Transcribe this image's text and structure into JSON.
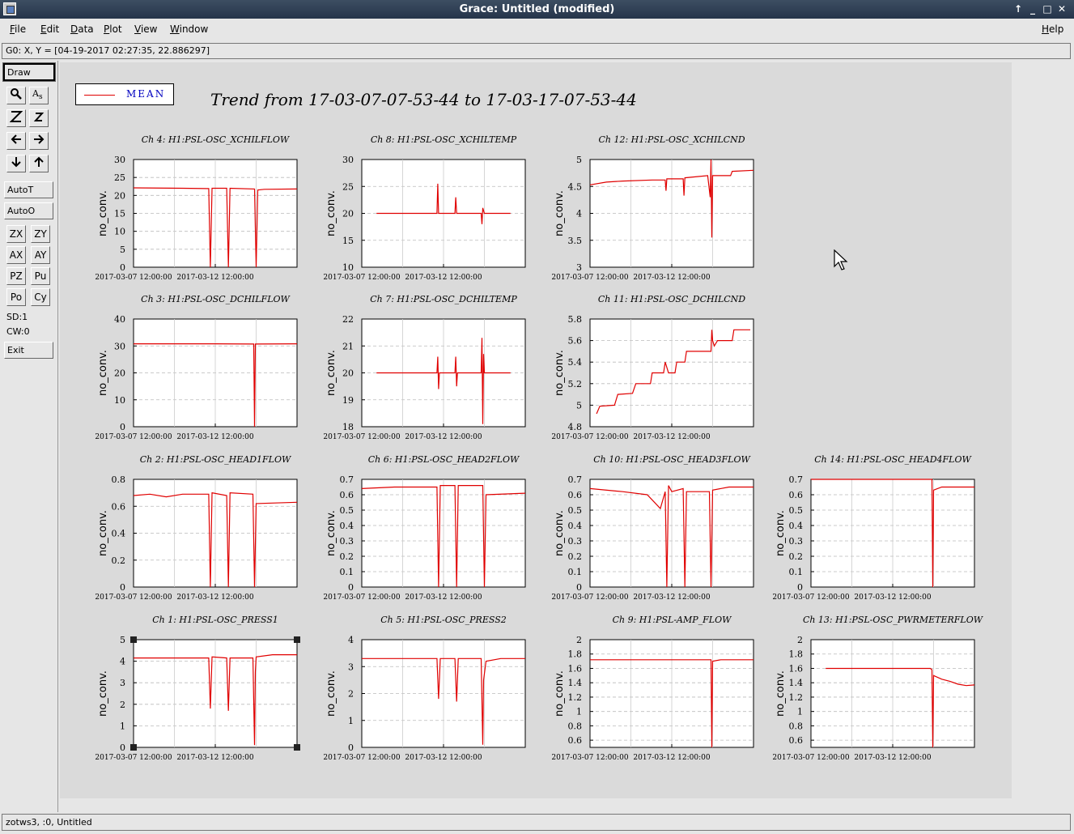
{
  "window": {
    "title": "Grace: Untitled (modified)"
  },
  "menu": [
    {
      "label": "File",
      "u": "F",
      "rest": "ile"
    },
    {
      "label": "Edit",
      "u": "E",
      "rest": "dit"
    },
    {
      "label": "Data",
      "u": "D",
      "rest": "ata"
    },
    {
      "label": "Plot",
      "u": "P",
      "rest": "lot"
    },
    {
      "label": "View",
      "u": "V",
      "rest": "iew"
    },
    {
      "label": "Window",
      "u": "W",
      "rest": "indow"
    }
  ],
  "help_menu": {
    "u": "H",
    "rest": "elp"
  },
  "locator": "G0: X, Y = [04-19-2017 02:27:35, 22.886297]",
  "toolbar": {
    "draw": "Draw",
    "zoom_icon": "magnifier-icon",
    "autot": "AutoT",
    "autoo": "AutoO",
    "zx": "ZX",
    "zy": "ZY",
    "ax": "AX",
    "ay": "AY",
    "pz": "PZ",
    "pu": "Pu",
    "po": "Po",
    "cy": "Cy",
    "sd": "SD:1",
    "cw": "CW:0",
    "exit": "Exit"
  },
  "status": "zotws3, :0, Untitled",
  "legend": {
    "label": "MEAN",
    "color": "#e00000"
  },
  "main_title": "Trend from 17-03-07-07-53-44 to 17-03-17-07-53-44",
  "chart_data": [
    {
      "type": "line",
      "title": "Ch 4: H1:PSL-OSC_XCHILFLOW",
      "ylabel": "no_conv.",
      "yticks": [
        "0",
        "5",
        "10",
        "15",
        "20",
        "25",
        "30"
      ],
      "ylim": [
        0,
        30
      ],
      "xticks": [
        "2017-03-07 12:00:00",
        "2017-03-12 12:00:00"
      ],
      "series": [
        {
          "points": [
            [
              0,
              22.1
            ],
            [
              0.3,
              22.0
            ],
            [
              0.46,
              21.9
            ],
            [
              0.47,
              0
            ],
            [
              0.48,
              22.0
            ],
            [
              0.57,
              22.0
            ],
            [
              0.58,
              0
            ],
            [
              0.59,
              22.0
            ],
            [
              0.74,
              21.8
            ],
            [
              0.75,
              0
            ],
            [
              0.76,
              21.5
            ],
            [
              0.8,
              21.7
            ],
            [
              1,
              21.8
            ]
          ]
        }
      ]
    },
    {
      "type": "line",
      "title": "Ch 8: H1:PSL-OSC_XCHILTEMP",
      "ylabel": "no_conv.",
      "yticks": [
        "10",
        "15",
        "20",
        "25",
        "30"
      ],
      "ylim": [
        10,
        30
      ],
      "xticks": [
        "2017-03-07 12:00:00",
        "2017-03-12 12:00:00"
      ],
      "series": [
        {
          "points": [
            [
              0.09,
              20
            ],
            [
              0.46,
              20
            ],
            [
              0.465,
              25.5
            ],
            [
              0.47,
              20
            ],
            [
              0.57,
              20
            ],
            [
              0.575,
              23
            ],
            [
              0.58,
              20
            ],
            [
              0.73,
              20
            ],
            [
              0.735,
              18
            ],
            [
              0.74,
              21
            ],
            [
              0.75,
              20
            ],
            [
              0.91,
              20
            ]
          ]
        }
      ]
    },
    {
      "type": "line",
      "title": "Ch 12: H1:PSL-OSC_XCHILCND",
      "ylabel": "no_conv.",
      "yticks": [
        "3",
        "3.5",
        "4",
        "4.5",
        "5"
      ],
      "ylim": [
        3,
        5
      ],
      "xticks": [
        "2017-03-07 12:00:00",
        "2017-03-12 12:00:00"
      ],
      "series": [
        {
          "points": [
            [
              0,
              4.53
            ],
            [
              0.1,
              4.58
            ],
            [
              0.2,
              4.6
            ],
            [
              0.38,
              4.62
            ],
            [
              0.46,
              4.62
            ],
            [
              0.465,
              4.42
            ],
            [
              0.47,
              4.64
            ],
            [
              0.57,
              4.64
            ],
            [
              0.575,
              4.33
            ],
            [
              0.58,
              4.66
            ],
            [
              0.72,
              4.7
            ],
            [
              0.735,
              4.3
            ],
            [
              0.74,
              5.0
            ],
            [
              0.745,
              3.55
            ],
            [
              0.75,
              4.7
            ],
            [
              0.86,
              4.7
            ],
            [
              0.87,
              4.78
            ],
            [
              1,
              4.8
            ]
          ]
        }
      ]
    },
    {
      "type": "line",
      "title": "Ch 3: H1:PSL-OSC_DCHILFLOW",
      "ylabel": "no_conv.",
      "yticks": [
        "0",
        "10",
        "20",
        "30",
        "40"
      ],
      "ylim": [
        0,
        40
      ],
      "xticks": [
        "2017-03-07 12:00:00",
        "2017-03-12 12:00:00"
      ],
      "series": [
        {
          "points": [
            [
              0,
              30.8
            ],
            [
              0.5,
              30.8
            ],
            [
              0.735,
              30.7
            ],
            [
              0.74,
              0
            ],
            [
              0.745,
              30.7
            ],
            [
              1,
              30.8
            ]
          ]
        }
      ]
    },
    {
      "type": "line",
      "title": "Ch 7: H1:PSL-OSC_DCHILTEMP",
      "ylabel": "no_conv.",
      "yticks": [
        "18",
        "19",
        "20",
        "21",
        "22"
      ],
      "ylim": [
        18,
        22
      ],
      "xticks": [
        "2017-03-07 12:00:00",
        "2017-03-12 12:00:00"
      ],
      "series": [
        {
          "points": [
            [
              0.09,
              20
            ],
            [
              0.46,
              20
            ],
            [
              0.465,
              20.6
            ],
            [
              0.47,
              19.4
            ],
            [
              0.475,
              20
            ],
            [
              0.57,
              20
            ],
            [
              0.575,
              20.6
            ],
            [
              0.58,
              19.5
            ],
            [
              0.585,
              20
            ],
            [
              0.73,
              20
            ],
            [
              0.735,
              21.3
            ],
            [
              0.74,
              18.1
            ],
            [
              0.745,
              20.7
            ],
            [
              0.75,
              20
            ],
            [
              0.91,
              20
            ]
          ]
        }
      ]
    },
    {
      "type": "line",
      "title": "Ch 11: H1:PSL-OSC_DCHILCND",
      "ylabel": "no_conv.",
      "yticks": [
        "4.8",
        "5",
        "5.2",
        "5.4",
        "5.6",
        "5.8"
      ],
      "ylim": [
        4.8,
        5.8
      ],
      "xticks": [
        "2017-03-07 12:00:00",
        "2017-03-12 12:00:00"
      ],
      "series": [
        {
          "points": [
            [
              0.04,
              4.92
            ],
            [
              0.06,
              4.99
            ],
            [
              0.15,
              5.0
            ],
            [
              0.17,
              5.1
            ],
            [
              0.26,
              5.11
            ],
            [
              0.28,
              5.2
            ],
            [
              0.37,
              5.2
            ],
            [
              0.38,
              5.3
            ],
            [
              0.45,
              5.3
            ],
            [
              0.46,
              5.4
            ],
            [
              0.48,
              5.3
            ],
            [
              0.52,
              5.3
            ],
            [
              0.53,
              5.4
            ],
            [
              0.58,
              5.4
            ],
            [
              0.59,
              5.5
            ],
            [
              0.66,
              5.5
            ],
            [
              0.67,
              5.5
            ],
            [
              0.74,
              5.5
            ],
            [
              0.745,
              5.7
            ],
            [
              0.75,
              5.6
            ],
            [
              0.76,
              5.55
            ],
            [
              0.78,
              5.6
            ],
            [
              0.87,
              5.6
            ],
            [
              0.88,
              5.7
            ],
            [
              0.98,
              5.7
            ]
          ]
        }
      ]
    },
    {
      "type": "line",
      "title": "Ch 2: H1:PSL-OSC_HEAD1FLOW",
      "ylabel": "no_conv.",
      "yticks": [
        "0",
        "0.2",
        "0.4",
        "0.6",
        "0.8"
      ],
      "ylim": [
        0,
        0.8
      ],
      "xticks": [
        "2017-03-07 12:00:00",
        "2017-03-12 12:00:00"
      ],
      "series": [
        {
          "points": [
            [
              0,
              0.68
            ],
            [
              0.1,
              0.69
            ],
            [
              0.2,
              0.67
            ],
            [
              0.3,
              0.69
            ],
            [
              0.46,
              0.69
            ],
            [
              0.47,
              0
            ],
            [
              0.48,
              0.7
            ],
            [
              0.57,
              0.68
            ],
            [
              0.58,
              0
            ],
            [
              0.59,
              0.7
            ],
            [
              0.73,
              0.69
            ],
            [
              0.74,
              0
            ],
            [
              0.75,
              0.62
            ],
            [
              1,
              0.63
            ]
          ]
        }
      ]
    },
    {
      "type": "line",
      "title": "Ch 6: H1:PSL-OSC_HEAD2FLOW",
      "ylabel": "no_conv.",
      "yticks": [
        "0",
        "0.1",
        "0.2",
        "0.3",
        "0.4",
        "0.5",
        "0.6",
        "0.7"
      ],
      "ylim": [
        0,
        0.7
      ],
      "xticks": [
        "2017-03-07 12:00:00",
        "2017-03-12 12:00:00"
      ],
      "series": [
        {
          "points": [
            [
              0,
              0.64
            ],
            [
              0.2,
              0.65
            ],
            [
              0.46,
              0.65
            ],
            [
              0.47,
              0
            ],
            [
              0.48,
              0.66
            ],
            [
              0.57,
              0.66
            ],
            [
              0.58,
              0
            ],
            [
              0.59,
              0.66
            ],
            [
              0.74,
              0.66
            ],
            [
              0.75,
              0
            ],
            [
              0.76,
              0.6
            ],
            [
              1,
              0.61
            ]
          ]
        }
      ]
    },
    {
      "type": "line",
      "title": "Ch 10: H1:PSL-OSC_HEAD3FLOW",
      "ylabel": "no_conv.",
      "yticks": [
        "0",
        "0.1",
        "0.2",
        "0.3",
        "0.4",
        "0.5",
        "0.6",
        "0.7"
      ],
      "ylim": [
        0,
        0.7
      ],
      "xticks": [
        "2017-03-07 12:00:00",
        "2017-03-12 12:00:00"
      ],
      "series": [
        {
          "points": [
            [
              0,
              0.64
            ],
            [
              0.2,
              0.62
            ],
            [
              0.35,
              0.6
            ],
            [
              0.43,
              0.51
            ],
            [
              0.46,
              0.62
            ],
            [
              0.47,
              0
            ],
            [
              0.48,
              0.66
            ],
            [
              0.5,
              0.62
            ],
            [
              0.57,
              0.64
            ],
            [
              0.58,
              0
            ],
            [
              0.59,
              0.62
            ],
            [
              0.73,
              0.62
            ],
            [
              0.74,
              0
            ],
            [
              0.75,
              0.63
            ],
            [
              0.85,
              0.65
            ],
            [
              1,
              0.65
            ]
          ]
        }
      ]
    },
    {
      "type": "line",
      "title": "Ch 14: H1:PSL-OSC_HEAD4FLOW",
      "ylabel": "no_conv.",
      "yticks": [
        "0",
        "0.1",
        "0.2",
        "0.3",
        "0.4",
        "0.5",
        "0.6",
        "0.7"
      ],
      "ylim": [
        0,
        0.7
      ],
      "xticks": [
        "2017-03-07 12:00:00",
        "2017-03-12 12:00:00"
      ],
      "series": [
        {
          "points": [
            [
              0,
              0.7
            ],
            [
              0.74,
              0.7
            ],
            [
              0.745,
              0
            ],
            [
              0.75,
              0.63
            ],
            [
              0.8,
              0.65
            ],
            [
              1,
              0.65
            ]
          ]
        }
      ]
    },
    {
      "type": "line",
      "title": "Ch 1: H1:PSL-OSC_PRESS1",
      "ylabel": "no_conv.",
      "yticks": [
        "0",
        "1",
        "2",
        "3",
        "4",
        "5"
      ],
      "ylim": [
        0,
        5
      ],
      "xticks": [
        "2017-03-07 12:00:00",
        "2017-03-12 12:00:00"
      ],
      "series": [
        {
          "points": [
            [
              0,
              4.15
            ],
            [
              0.46,
              4.15
            ],
            [
              0.47,
              1.8
            ],
            [
              0.48,
              4.2
            ],
            [
              0.57,
              4.15
            ],
            [
              0.58,
              1.7
            ],
            [
              0.59,
              4.15
            ],
            [
              0.73,
              4.15
            ],
            [
              0.74,
              0.1
            ],
            [
              0.745,
              3.5
            ],
            [
              0.75,
              4.2
            ],
            [
              0.85,
              4.3
            ],
            [
              1,
              4.3
            ]
          ]
        }
      ]
    },
    {
      "type": "line",
      "title": "Ch 5: H1:PSL-OSC_PRESS2",
      "ylabel": "no_conv.",
      "yticks": [
        "0",
        "1",
        "2",
        "3",
        "4"
      ],
      "ylim": [
        0,
        4
      ],
      "xticks": [
        "2017-03-07 12:00:00",
        "2017-03-12 12:00:00"
      ],
      "series": [
        {
          "points": [
            [
              0,
              3.3
            ],
            [
              0.46,
              3.3
            ],
            [
              0.47,
              1.8
            ],
            [
              0.48,
              3.3
            ],
            [
              0.57,
              3.3
            ],
            [
              0.58,
              1.7
            ],
            [
              0.59,
              3.3
            ],
            [
              0.73,
              3.3
            ],
            [
              0.74,
              0.1
            ],
            [
              0.745,
              2.5
            ],
            [
              0.76,
              3.2
            ],
            [
              0.85,
              3.3
            ],
            [
              1,
              3.3
            ]
          ]
        }
      ]
    },
    {
      "type": "line",
      "title": "Ch 9: H1:PSL-AMP_FLOW",
      "ylabel": "no_conv.",
      "yticks": [
        "0.6",
        "0.8",
        "1",
        "1.2",
        "1.4",
        "1.6",
        "1.8",
        "2"
      ],
      "ylim": [
        0.5,
        2
      ],
      "xticks": [
        "2017-03-07 12:00:00",
        "2017-03-12 12:00:00"
      ],
      "series": [
        {
          "points": [
            [
              0,
              1.72
            ],
            [
              0.74,
              1.72
            ],
            [
              0.745,
              0.5
            ],
            [
              0.75,
              1.7
            ],
            [
              0.8,
              1.72
            ],
            [
              1,
              1.72
            ]
          ]
        }
      ]
    },
    {
      "type": "line",
      "title": "Ch 13: H1:PSL-OSC_PWRMETERFLOW",
      "ylabel": "no_conv.",
      "yticks": [
        "0.6",
        "0.8",
        "1",
        "1.2",
        "1.4",
        "1.6",
        "1.8",
        "2"
      ],
      "ylim": [
        0.5,
        2
      ],
      "xticks": [
        "2017-03-07 12:00:00",
        "2017-03-12 12:00:00"
      ],
      "series": [
        {
          "points": [
            [
              0.09,
              1.6
            ],
            [
              0.73,
              1.6
            ],
            [
              0.74,
              1.58
            ],
            [
              0.745,
              0.5
            ],
            [
              0.75,
              1.5
            ],
            [
              0.8,
              1.45
            ],
            [
              0.85,
              1.42
            ],
            [
              0.9,
              1.38
            ],
            [
              0.95,
              1.36
            ],
            [
              1,
              1.37
            ]
          ]
        }
      ]
    }
  ]
}
